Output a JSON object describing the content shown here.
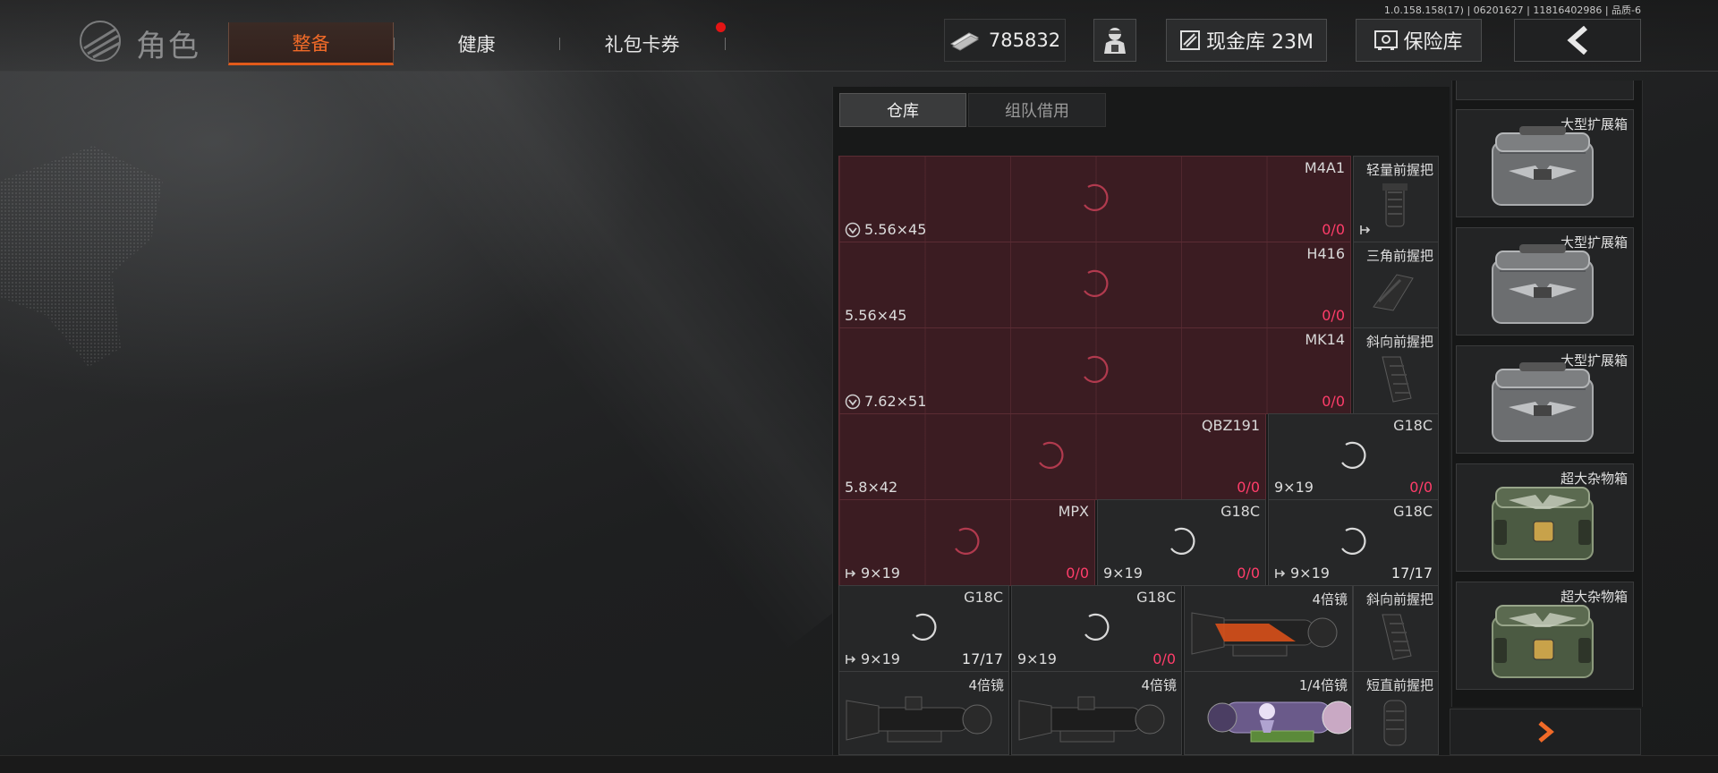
{
  "version_text": "1.0.158.158(17) | 06201627 | 11816402986 | 品质-6",
  "header": {
    "title": "角色",
    "tabs": [
      {
        "label": "整备",
        "active": true
      },
      {
        "label": "健康",
        "active": false
      },
      {
        "label": "礼包卡券",
        "active": false,
        "notification": true
      }
    ],
    "money": "785832",
    "cash_vault": "现金库 23M",
    "safe": "保险库"
  },
  "warehouse": {
    "subtabs": [
      "仓库",
      "组队借用"
    ],
    "weapons": [
      {
        "name": "M4A1",
        "caliber": "5.56×45",
        "ammo_loaded": "0",
        "ammo_capacity": "0",
        "marked": true
      },
      {
        "name": "H416",
        "caliber": "5.56×45",
        "ammo_loaded": "0",
        "ammo_capacity": "0"
      },
      {
        "name": "MK14",
        "caliber": "7.62×51",
        "ammo_loaded": "0",
        "ammo_capacity": "0",
        "marked": true
      },
      {
        "name": "QBZ191",
        "caliber": "5.8×42",
        "ammo_loaded": "0",
        "ammo_capacity": "0"
      },
      {
        "name": "G18C",
        "caliber": "9×19",
        "ammo_loaded": "0",
        "ammo_capacity": "0"
      },
      {
        "name": "MPX",
        "caliber": "9×19",
        "ammo_loaded": "0",
        "ammo_capacity": "0"
      },
      {
        "name": "G18C",
        "caliber": "9×19",
        "ammo_loaded": "0",
        "ammo_capacity": "0"
      },
      {
        "name": "G18C",
        "caliber": "9×19",
        "ammo_loaded": "17",
        "ammo_capacity": "17"
      },
      {
        "name": "G18C",
        "caliber": "9×19",
        "ammo_loaded": "17",
        "ammo_capacity": "17"
      },
      {
        "name": "G18C",
        "caliber": "9×19",
        "ammo_loaded": "0",
        "ammo_capacity": "0"
      }
    ],
    "attachments": [
      {
        "name": "轻量前握把"
      },
      {
        "name": "三角前握把"
      },
      {
        "name": "斜向前握把"
      },
      {
        "name": "斜向前握把"
      },
      {
        "name": "短直前握把"
      }
    ],
    "scopes": [
      {
        "name": "4倍镜"
      },
      {
        "name": "4倍镜"
      },
      {
        "name": "4倍镜"
      },
      {
        "name": "1/4倍镜"
      }
    ]
  },
  "containers": [
    {
      "name": "大型扩展箱",
      "kind": "silver"
    },
    {
      "name": "大型扩展箱",
      "kind": "silver"
    },
    {
      "name": "大型扩展箱",
      "kind": "silver"
    },
    {
      "name": "超大杂物箱",
      "kind": "green"
    },
    {
      "name": "超大杂物箱",
      "kind": "green"
    }
  ],
  "colors": {
    "accent": "#f06a28",
    "ammo_empty": "#ff3d6a",
    "red_cell": "#3b1c22"
  }
}
